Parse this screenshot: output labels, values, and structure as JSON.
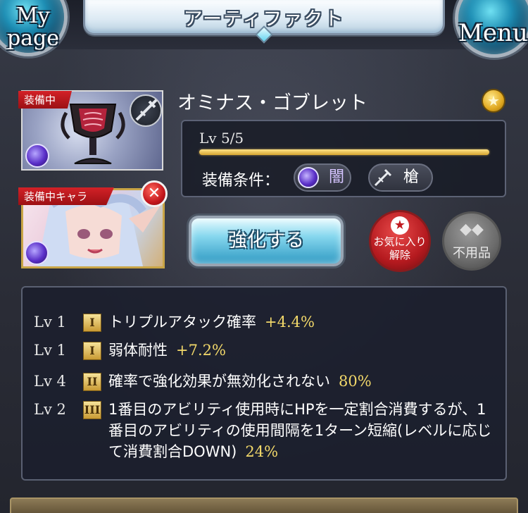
{
  "header": {
    "title": "アーティファクト",
    "mypage_label": "My\npage",
    "menu_label": "Menu"
  },
  "item": {
    "name": "オミナス・ゴブレット",
    "equipped_tag": "装備中",
    "equipped_char_tag": "装備中キャラ",
    "level_text": "Lv 5/5",
    "level_fraction": 1.0,
    "requirement_label": "装備条件：",
    "element": "闇",
    "weapon": "槍"
  },
  "buttons": {
    "upgrade": "強化する",
    "unfavorite_line1": "お気に入り",
    "unfavorite_line2": "解除",
    "junk": "不用品",
    "remove_icon": "close-icon"
  },
  "skills": [
    {
      "lv": "Lv 1",
      "rank": "I",
      "desc": "トリプルアタック確率",
      "value": "+4.4%"
    },
    {
      "lv": "Lv 1",
      "rank": "I",
      "desc": "弱体耐性",
      "value": "+7.2%"
    },
    {
      "lv": "Lv 4",
      "rank": "II",
      "desc": "確率で強化効果が無効化されない",
      "value": "80%"
    },
    {
      "lv": "Lv 2",
      "rank": "III",
      "desc": "1番目のアビリティ使用時にHPを一定割合消費するが、1番目のアビリティの使用間隔を1ターン短縮(レベルに応じて消費割合DOWN)",
      "value": "24%"
    }
  ],
  "colors": {
    "accent_gold": "#f3d96a",
    "equipped_red": "#d32127",
    "dark_element": "#5a2fc8"
  }
}
